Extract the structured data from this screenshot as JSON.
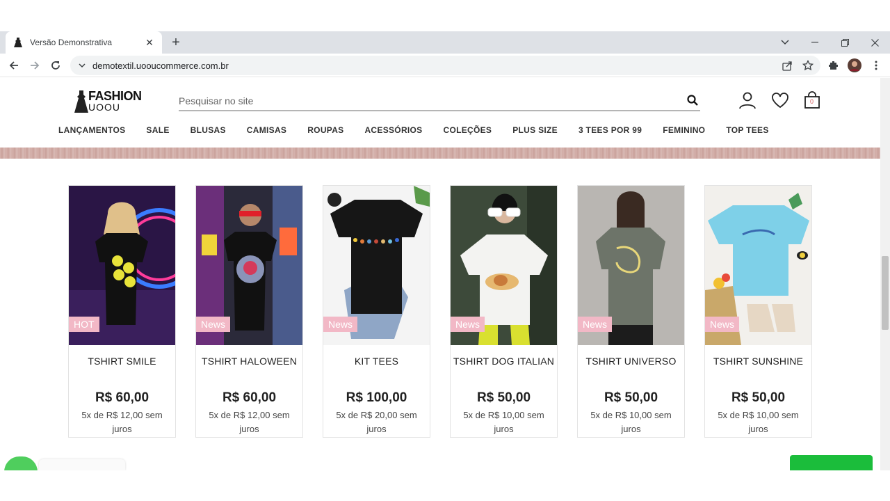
{
  "browser": {
    "tab_title": "Versão Demonstrativa",
    "url": "demotextil.uooucommerce.com.br"
  },
  "site": {
    "logo_top": "FASHION",
    "logo_bottom": "UOOU",
    "search_placeholder": "Pesquisar no site",
    "cart_count": "0",
    "menu": [
      "LANÇAMENTOS",
      "SALE",
      "BLUSAS",
      "CAMISAS",
      "ROUPAS",
      "ACESSÓRIOS",
      "COLEÇÕES",
      "PLUS SIZE",
      "3 TEES POR 99",
      "FEMININO",
      "TOP TEES"
    ]
  },
  "products": [
    {
      "badge": "HOT",
      "name": "TSHIRT SMILE",
      "price": "R$ 60,00",
      "installments": "5x de R$ 12,00 sem juros"
    },
    {
      "badge": "News",
      "name": "TSHIRT HALOWEEN",
      "price": "R$ 60,00",
      "installments": "5x de R$ 12,00 sem juros"
    },
    {
      "badge": "News",
      "name": "KIT TEES",
      "price": "R$ 100,00",
      "installments": "5x de R$ 20,00 sem juros"
    },
    {
      "badge": "News",
      "name": "TSHIRT DOG ITALIAN",
      "price": "R$ 50,00",
      "installments": "5x de R$ 10,00 sem juros"
    },
    {
      "badge": "News",
      "name": "TSHIRT UNIVERSO",
      "price": "R$ 50,00",
      "installments": "5x de R$ 10,00 sem juros"
    },
    {
      "badge": "News",
      "name": "TSHIRT SUNSHINE",
      "price": "R$ 50,00",
      "installments": "5x de R$ 10,00 sem juros"
    }
  ],
  "colors": {
    "badge": "#f2b8c6",
    "whatsapp": "#4fce5d",
    "cta_green": "#1bbd3b"
  }
}
